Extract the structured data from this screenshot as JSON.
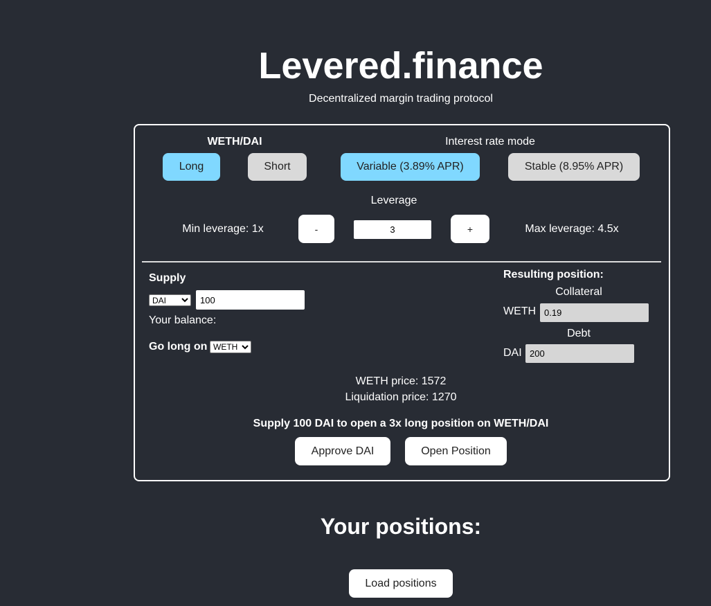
{
  "header": {
    "title": "Levered.finance",
    "subtitle": "Decentralized margin trading protocol"
  },
  "colors": {
    "background": "#282c34",
    "selected": "#80d8ff",
    "unselected": "#d9d9d9"
  },
  "trade": {
    "pair": "WETH/DAI",
    "direction": {
      "long": "Long",
      "short": "Short",
      "selected": "Long"
    },
    "interest_rate": {
      "label": "Interest rate mode",
      "variable": "Variable (3.89% APR)",
      "stable": "Stable (8.95% APR)",
      "selected": "Variable"
    },
    "leverage": {
      "label": "Leverage",
      "min": "Min leverage: 1x",
      "max": "Max leverage: 4.5x",
      "decrement": "-",
      "increment": "+",
      "value": "3"
    },
    "supply": {
      "label": "Supply",
      "token": "DAI",
      "amount": "100",
      "balance_label": "Your balance:",
      "go_long_label": "Go long on",
      "go_long_token": "WETH"
    },
    "result": {
      "label": "Resulting position:",
      "collateral_label": "Collateral",
      "collateral_token": "WETH",
      "collateral_value": "0.19",
      "debt_label": "Debt",
      "debt_token": "DAI",
      "debt_value": "200"
    },
    "price": "WETH price: 1572",
    "liquidation": "Liquidation price: 1270",
    "summary": "Supply 100 DAI to open a 3x long position on WETH/DAI",
    "approve": "Approve DAI",
    "open": "Open Position"
  },
  "positions": {
    "title": "Your positions:",
    "load": "Load positions"
  }
}
